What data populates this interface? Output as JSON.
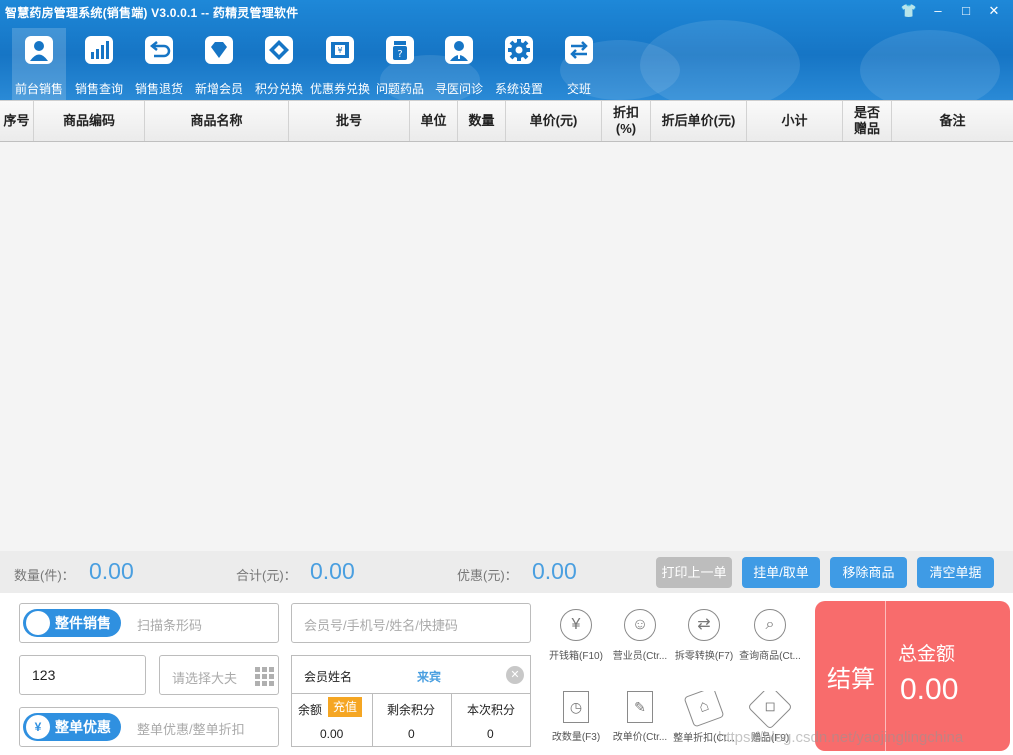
{
  "window": {
    "title": "智慧药房管理系统(销售端)    V3.0.0.1 -- 药精灵管理软件",
    "controls": [
      "👕",
      "–",
      "□",
      "✕"
    ]
  },
  "toolbar": [
    {
      "label": "前台销售",
      "icon": "person-icon",
      "active": true
    },
    {
      "label": "销售查询",
      "icon": "bar-chart-icon",
      "active": false
    },
    {
      "label": "销售退货",
      "icon": "return-arrow-icon",
      "active": false
    },
    {
      "label": "新增会员",
      "icon": "diamond-icon",
      "active": false
    },
    {
      "label": "积分兑换",
      "icon": "exchange-diamond-icon",
      "active": false
    },
    {
      "label": "优惠券兑换",
      "icon": "coupon-icon",
      "active": false
    },
    {
      "label": "问题药品",
      "icon": "question-bottle-icon",
      "active": false
    },
    {
      "label": "寻医问诊",
      "icon": "doctor-icon",
      "active": false
    },
    {
      "label": "系统设置",
      "icon": "gear-icon",
      "active": false
    },
    {
      "label": "交班",
      "icon": "swap-arrows-icon",
      "active": false
    }
  ],
  "table": {
    "columns": [
      "序号",
      "商品编码",
      "商品名称",
      "批号",
      "单位",
      "数量",
      "单价(元)",
      "折扣\n(%)",
      "折后单价(元)",
      "小计",
      "是否\n赠品",
      "备注"
    ],
    "rows": []
  },
  "totals": {
    "qty_label": "数量(件)：",
    "qty_value": "0.00",
    "sum_label": "合计(元)：",
    "sum_value": "0.00",
    "discount_label": "优惠(元)：",
    "discount_value": "0.00"
  },
  "actions": {
    "print_last": "打印上一单",
    "hold": "挂单/取单",
    "remove": "移除商品",
    "clear": "清空单据"
  },
  "entry": {
    "mode_toggle": "整件销售",
    "barcode_placeholder": "扫描条形码",
    "quantity_value": "123",
    "doctor_placeholder": "请选择大夫",
    "discount_toggle": "整单优惠",
    "discount_toggle_icon": "¥",
    "discount_placeholder": "整单优惠/整单折扣"
  },
  "member": {
    "search_placeholder": "会员号/手机号/姓名/快捷码",
    "name_label": "会员姓名",
    "name_value": "来宾",
    "balance_label": "余额",
    "recharge_label": "充值",
    "remaining_points_label": "剩余积分",
    "current_points_label": "本次积分",
    "balance_value": "0.00",
    "remaining_points_value": "0",
    "current_points_value": "0"
  },
  "function_keys": [
    {
      "label": "开钱箱(F10)",
      "icon": "yen-icon",
      "glyph": "¥"
    },
    {
      "label": "营业员(Ctr...",
      "icon": "user-icon",
      "glyph": "☺"
    },
    {
      "label": "拆零转换(F7)",
      "icon": "convert-icon",
      "glyph": "⇄"
    },
    {
      "label": "查询商品(Ct...",
      "icon": "magnifier-icon",
      "glyph": "⌕"
    },
    {
      "label": "改数量(F3)",
      "icon": "clock-doc-icon",
      "glyph": "◷"
    },
    {
      "label": "改单价(Ctr...",
      "icon": "edit-list-icon",
      "glyph": "✎"
    },
    {
      "label": "整单折扣(Ct...",
      "icon": "sale-tag-icon",
      "glyph": "⌂"
    },
    {
      "label": "赠品(F9)",
      "icon": "gift-tag-icon",
      "glyph": "◇"
    }
  ],
  "payment": {
    "checkout_label": "结算",
    "total_label": "总金额",
    "total_value": "0.00"
  },
  "watermark": "https://blog.csdn.net/yaojinglingchina",
  "colors": {
    "header": "#1675c5",
    "accent": "#3f9be5",
    "pay": "#f86c6c",
    "recharge": "#f5a623"
  }
}
